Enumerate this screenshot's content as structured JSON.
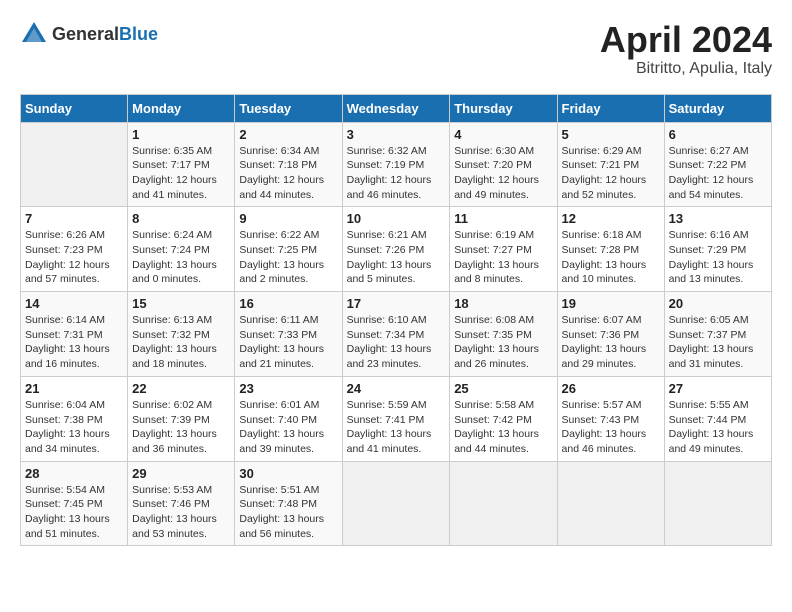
{
  "header": {
    "logo_general": "General",
    "logo_blue": "Blue",
    "month_title": "April 2024",
    "location": "Bitritto, Apulia, Italy"
  },
  "days_of_week": [
    "Sunday",
    "Monday",
    "Tuesday",
    "Wednesday",
    "Thursday",
    "Friday",
    "Saturday"
  ],
  "weeks": [
    [
      {
        "day": "",
        "info": ""
      },
      {
        "day": "1",
        "info": "Sunrise: 6:35 AM\nSunset: 7:17 PM\nDaylight: 12 hours\nand 41 minutes."
      },
      {
        "day": "2",
        "info": "Sunrise: 6:34 AM\nSunset: 7:18 PM\nDaylight: 12 hours\nand 44 minutes."
      },
      {
        "day": "3",
        "info": "Sunrise: 6:32 AM\nSunset: 7:19 PM\nDaylight: 12 hours\nand 46 minutes."
      },
      {
        "day": "4",
        "info": "Sunrise: 6:30 AM\nSunset: 7:20 PM\nDaylight: 12 hours\nand 49 minutes."
      },
      {
        "day": "5",
        "info": "Sunrise: 6:29 AM\nSunset: 7:21 PM\nDaylight: 12 hours\nand 52 minutes."
      },
      {
        "day": "6",
        "info": "Sunrise: 6:27 AM\nSunset: 7:22 PM\nDaylight: 12 hours\nand 54 minutes."
      }
    ],
    [
      {
        "day": "7",
        "info": "Sunrise: 6:26 AM\nSunset: 7:23 PM\nDaylight: 12 hours\nand 57 minutes."
      },
      {
        "day": "8",
        "info": "Sunrise: 6:24 AM\nSunset: 7:24 PM\nDaylight: 13 hours\nand 0 minutes."
      },
      {
        "day": "9",
        "info": "Sunrise: 6:22 AM\nSunset: 7:25 PM\nDaylight: 13 hours\nand 2 minutes."
      },
      {
        "day": "10",
        "info": "Sunrise: 6:21 AM\nSunset: 7:26 PM\nDaylight: 13 hours\nand 5 minutes."
      },
      {
        "day": "11",
        "info": "Sunrise: 6:19 AM\nSunset: 7:27 PM\nDaylight: 13 hours\nand 8 minutes."
      },
      {
        "day": "12",
        "info": "Sunrise: 6:18 AM\nSunset: 7:28 PM\nDaylight: 13 hours\nand 10 minutes."
      },
      {
        "day": "13",
        "info": "Sunrise: 6:16 AM\nSunset: 7:29 PM\nDaylight: 13 hours\nand 13 minutes."
      }
    ],
    [
      {
        "day": "14",
        "info": "Sunrise: 6:14 AM\nSunset: 7:31 PM\nDaylight: 13 hours\nand 16 minutes."
      },
      {
        "day": "15",
        "info": "Sunrise: 6:13 AM\nSunset: 7:32 PM\nDaylight: 13 hours\nand 18 minutes."
      },
      {
        "day": "16",
        "info": "Sunrise: 6:11 AM\nSunset: 7:33 PM\nDaylight: 13 hours\nand 21 minutes."
      },
      {
        "day": "17",
        "info": "Sunrise: 6:10 AM\nSunset: 7:34 PM\nDaylight: 13 hours\nand 23 minutes."
      },
      {
        "day": "18",
        "info": "Sunrise: 6:08 AM\nSunset: 7:35 PM\nDaylight: 13 hours\nand 26 minutes."
      },
      {
        "day": "19",
        "info": "Sunrise: 6:07 AM\nSunset: 7:36 PM\nDaylight: 13 hours\nand 29 minutes."
      },
      {
        "day": "20",
        "info": "Sunrise: 6:05 AM\nSunset: 7:37 PM\nDaylight: 13 hours\nand 31 minutes."
      }
    ],
    [
      {
        "day": "21",
        "info": "Sunrise: 6:04 AM\nSunset: 7:38 PM\nDaylight: 13 hours\nand 34 minutes."
      },
      {
        "day": "22",
        "info": "Sunrise: 6:02 AM\nSunset: 7:39 PM\nDaylight: 13 hours\nand 36 minutes."
      },
      {
        "day": "23",
        "info": "Sunrise: 6:01 AM\nSunset: 7:40 PM\nDaylight: 13 hours\nand 39 minutes."
      },
      {
        "day": "24",
        "info": "Sunrise: 5:59 AM\nSunset: 7:41 PM\nDaylight: 13 hours\nand 41 minutes."
      },
      {
        "day": "25",
        "info": "Sunrise: 5:58 AM\nSunset: 7:42 PM\nDaylight: 13 hours\nand 44 minutes."
      },
      {
        "day": "26",
        "info": "Sunrise: 5:57 AM\nSunset: 7:43 PM\nDaylight: 13 hours\nand 46 minutes."
      },
      {
        "day": "27",
        "info": "Sunrise: 5:55 AM\nSunset: 7:44 PM\nDaylight: 13 hours\nand 49 minutes."
      }
    ],
    [
      {
        "day": "28",
        "info": "Sunrise: 5:54 AM\nSunset: 7:45 PM\nDaylight: 13 hours\nand 51 minutes."
      },
      {
        "day": "29",
        "info": "Sunrise: 5:53 AM\nSunset: 7:46 PM\nDaylight: 13 hours\nand 53 minutes."
      },
      {
        "day": "30",
        "info": "Sunrise: 5:51 AM\nSunset: 7:48 PM\nDaylight: 13 hours\nand 56 minutes."
      },
      {
        "day": "",
        "info": ""
      },
      {
        "day": "",
        "info": ""
      },
      {
        "day": "",
        "info": ""
      },
      {
        "day": "",
        "info": ""
      }
    ]
  ]
}
